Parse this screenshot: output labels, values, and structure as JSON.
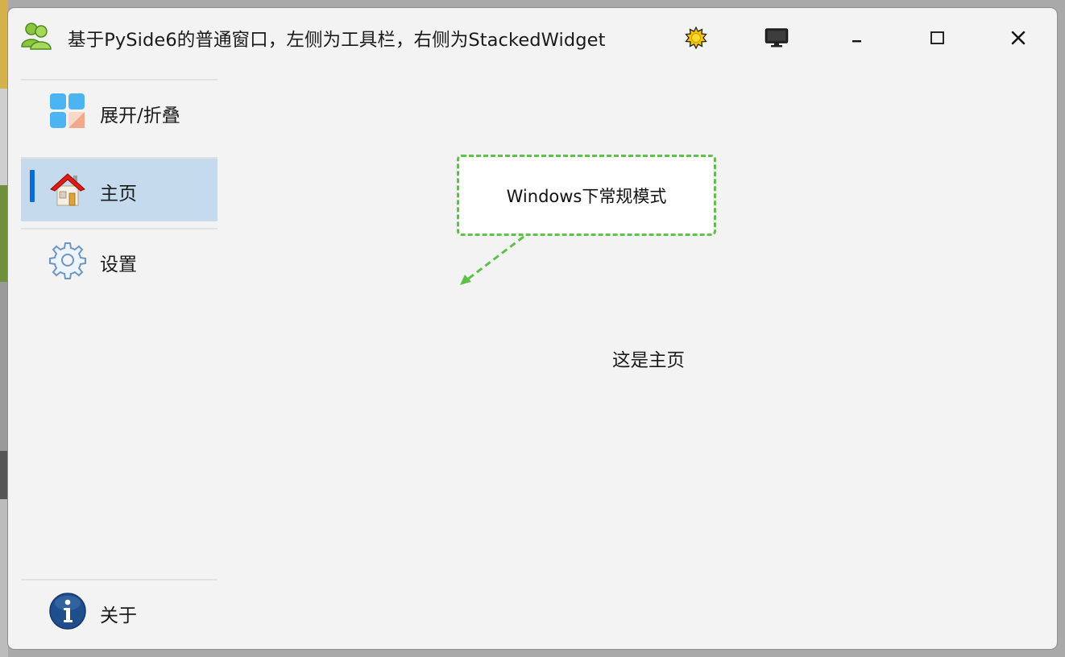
{
  "window": {
    "title": "基于PySide6的普通窗口，左侧为工具栏，右侧为StackedWidget",
    "app_icon": "users-icon",
    "buttons": [
      {
        "name": "theme-button",
        "icon": "sun-icon"
      },
      {
        "name": "fullscreen-button",
        "icon": "monitor-icon"
      },
      {
        "name": "minimize-button",
        "icon": "minimize-icon"
      },
      {
        "name": "maximize-button",
        "icon": "maximize-icon"
      },
      {
        "name": "close-button",
        "icon": "close-icon"
      }
    ]
  },
  "sidebar": {
    "items": [
      {
        "label": "展开/折叠",
        "icon": "expand-collapse-icon",
        "active": false
      },
      {
        "label": "主页",
        "icon": "home-icon",
        "active": true
      },
      {
        "label": "设置",
        "icon": "gear-icon",
        "active": false
      }
    ],
    "footer_item": {
      "label": "关于",
      "icon": "info-icon"
    },
    "active_color": "#c5daed",
    "indicator_color": "#0a6ad6"
  },
  "main": {
    "callout_text": "Windows下常规模式",
    "callout_border_color": "#5fc04a",
    "page_text": "这是主页"
  }
}
